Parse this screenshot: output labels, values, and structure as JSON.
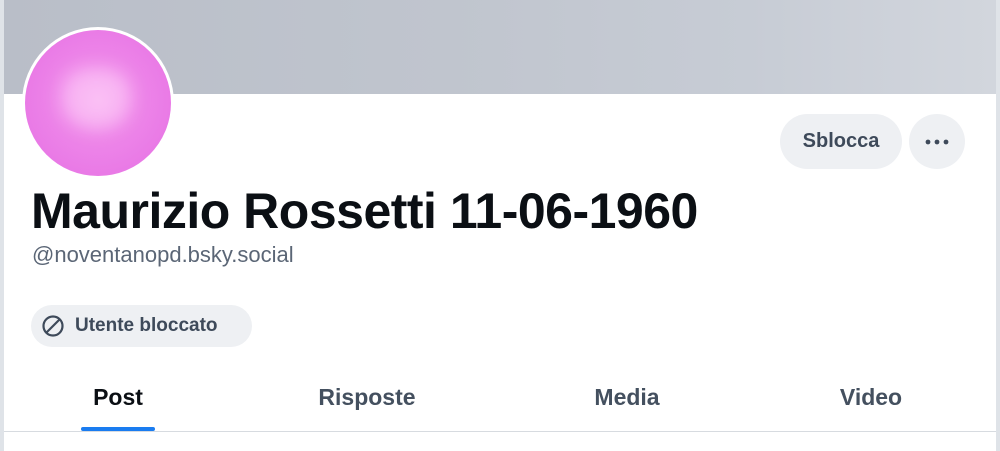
{
  "profile": {
    "display_name": "Maurizio Rossetti 11-06-1960",
    "handle": "@noventanopd.bsky.social",
    "avatar_color": "#ee87e9",
    "banner_color": "#c0c5ce"
  },
  "actions": {
    "unblock_label": "Sblocca",
    "more_icon": "ellipsis-icon"
  },
  "badge": {
    "icon": "blocked-icon",
    "label": "Utente bloccato"
  },
  "tabs": [
    {
      "label": "Post",
      "active": true
    },
    {
      "label": "Risposte",
      "active": false
    },
    {
      "label": "Media",
      "active": false
    },
    {
      "label": "Video",
      "active": false
    }
  ],
  "colors": {
    "accent": "#1a7cf0",
    "text_primary": "#0b0f14",
    "text_secondary": "#5b6676",
    "chip_background": "#eef0f3"
  }
}
